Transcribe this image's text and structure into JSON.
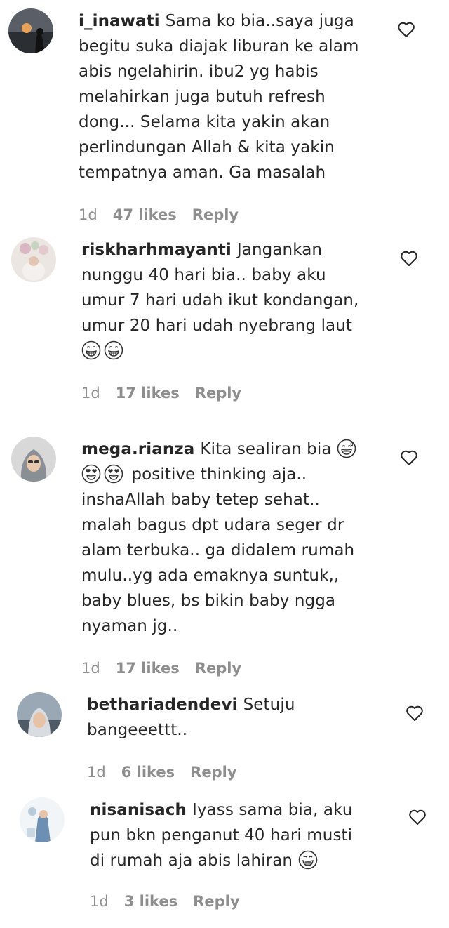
{
  "comments": [
    {
      "username": "i_inawati",
      "lines": [
        "Sama ko bia..saya juga",
        "begitu suka diajak liburan ke alam",
        "abis ngelahirin. ibu2 yg habis",
        "melahirkan juga butuh refresh",
        "dong... Selama kita yakin akan",
        "perlindungan Allah & kita yakin",
        "tempatnya aman. Ga masalah"
      ],
      "time": "1d",
      "likes": "47 likes",
      "reply": "Reply"
    },
    {
      "username": "riskharhmayanti",
      "lines": [
        "Jangankan",
        "nunggu 40 hari bia.. baby aku",
        "umur 7 hari udah ikut kondangan,",
        "umur 20 hari udah nyebrang laut"
      ],
      "time": "1d",
      "likes": "17 likes",
      "reply": "Reply"
    },
    {
      "username": "mega.rianza",
      "lines": [
        "Kita sealiran bia",
        "positive thinking aja..",
        "inshaAllah baby tetep sehat..",
        "malah bagus dpt udara seger dr",
        "alam terbuka.. ga didalem rumah",
        "mulu..yg ada emaknya suntuk,,",
        "baby blues, bs bikin baby ngga",
        "nyaman jg.."
      ],
      "time": "1d",
      "likes": "17 likes",
      "reply": "Reply"
    },
    {
      "username": "betharіadendevi",
      "lines": [
        "Setuju",
        "bangeeettt.."
      ],
      "time": "1d",
      "likes": "6 likes",
      "reply": "Reply"
    },
    {
      "username": "nisanisach",
      "lines": [
        "Iyass sama bia, aku",
        "pun bkn penganut 40 hari musti",
        "di rumah aja abis lahiran"
      ],
      "time": "1d",
      "likes": "3 likes",
      "reply": "Reply"
    }
  ],
  "icons": {
    "like": "heart-outline-icon",
    "emoji_grin": "grinning-face-icon",
    "emoji_sweat": "grinning-sweat-icon",
    "emoji_heart_eyes": "heart-eyes-icon"
  },
  "colors": {
    "text": "#262626",
    "meta": "#8e8e8e"
  }
}
